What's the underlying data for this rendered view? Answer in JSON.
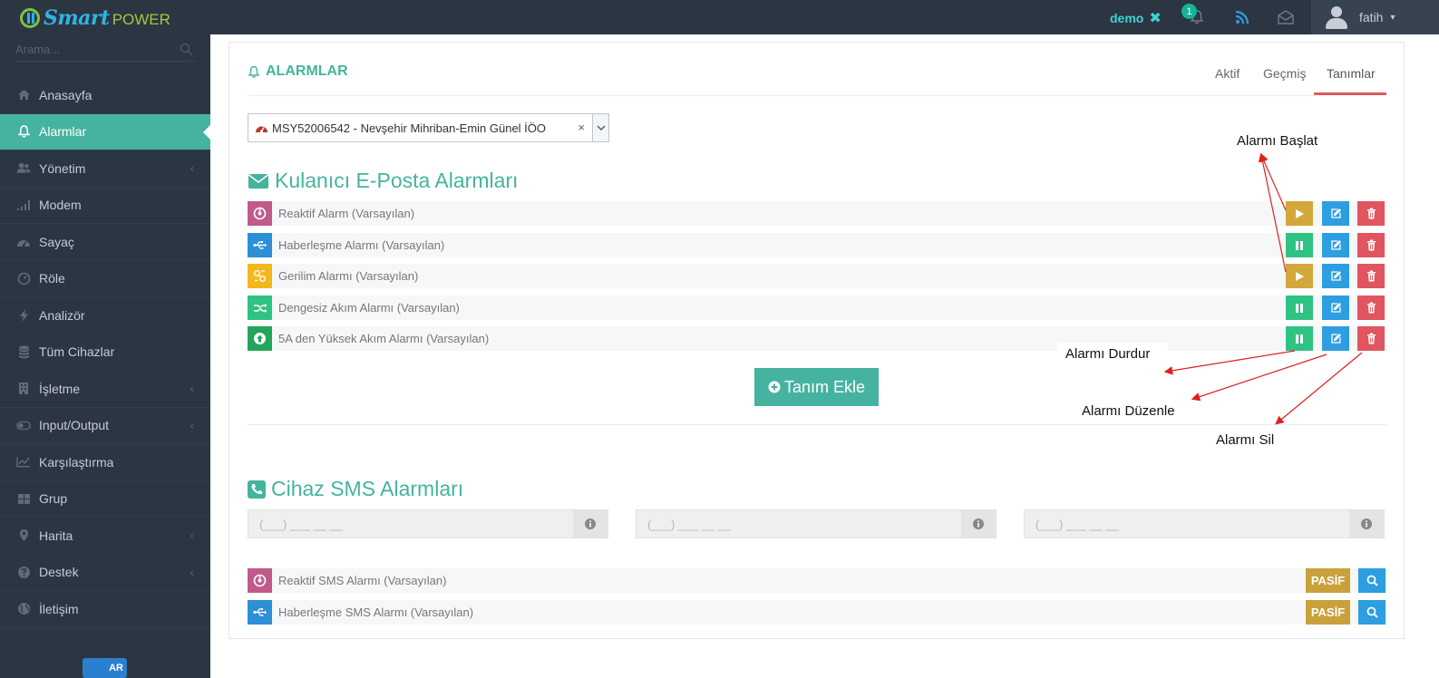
{
  "brand": {
    "smart": "Smart",
    "power": "POWER"
  },
  "topbar": {
    "demo_label": "demo",
    "notification_count": "1",
    "username": "fatih"
  },
  "sidebar": {
    "search_placeholder": "Arama...",
    "items": [
      {
        "label": "Anasayfa",
        "icon": "home-icon",
        "has_arrow": false
      },
      {
        "label": "Alarmlar",
        "icon": "bell-icon",
        "has_arrow": false,
        "active": true
      },
      {
        "label": "Yönetim",
        "icon": "users-icon",
        "has_arrow": true
      },
      {
        "label": "Modem",
        "icon": "signal-icon",
        "has_arrow": false
      },
      {
        "label": "Sayaç",
        "icon": "dashboard-icon",
        "has_arrow": false
      },
      {
        "label": "Röle",
        "icon": "gauge-icon",
        "has_arrow": false
      },
      {
        "label": "Analizör",
        "icon": "bolt-icon",
        "has_arrow": false
      },
      {
        "label": "Tüm Cihazlar",
        "icon": "database-icon",
        "has_arrow": false
      },
      {
        "label": "İşletme",
        "icon": "building-icon",
        "has_arrow": true
      },
      {
        "label": "Input/Output",
        "icon": "toggle-icon",
        "has_arrow": true
      },
      {
        "label": "Karşılaştırma",
        "icon": "line-chart-icon",
        "has_arrow": false
      },
      {
        "label": "Grup",
        "icon": "grid-icon",
        "has_arrow": false
      },
      {
        "label": "Harita",
        "icon": "map-marker-icon",
        "has_arrow": true
      },
      {
        "label": "Destek",
        "icon": "question-icon",
        "has_arrow": true
      },
      {
        "label": "İletişim",
        "icon": "globe-icon",
        "has_arrow": false
      }
    ],
    "bottom_logo_text": "AR"
  },
  "main": {
    "title": "ALARMLAR",
    "tabs": [
      {
        "label": "Aktif"
      },
      {
        "label": "Geçmiş"
      },
      {
        "label": "Tanımlar",
        "active": true
      }
    ],
    "device_select": {
      "value": "MSY52006542 - Nevşehir Mihriban-Emin Günel İÖO",
      "clear": "×"
    },
    "email_section": {
      "title": "Kulanıcı E-Posta Alarmları",
      "rows": [
        {
          "label": "Reaktif Alarm (Varsayılan)",
          "icon": "gauge-icon",
          "icon_color": "#c05a8a",
          "state": "play"
        },
        {
          "label": "Haberleşme Alarmı (Varsayılan)",
          "icon": "usb-icon",
          "icon_color": "#2d8fd5",
          "state": "pause"
        },
        {
          "label": "Gerilim Alarmı (Varsayılan)",
          "icon": "voltage-icon",
          "icon_color": "#f5b81c",
          "state": "play"
        },
        {
          "label": "Dengesiz Akım Alarmı (Varsayılan)",
          "icon": "shuffle-icon",
          "icon_color": "#2ec383",
          "state": "pause"
        },
        {
          "label": "5A den Yüksek Akım Alarmı (Varsayılan)",
          "icon": "arrow-up-circle-icon",
          "icon_color": "#23a55a",
          "state": "pause"
        }
      ],
      "add_button": "Tanım Ekle"
    },
    "sms_section": {
      "title": "Cihaz SMS Alarmları",
      "phone_placeholder": "(___) ___ __ __",
      "rows": [
        {
          "label": "Reaktif SMS Alarmı (Varsayılan)",
          "icon": "gauge-icon",
          "icon_color": "#c05a8a",
          "status": "PASİF"
        },
        {
          "label": "Haberleşme SMS Alarmı (Varsayılan)",
          "icon": "usb-icon",
          "icon_color": "#2d8fd5",
          "status": "PASİF"
        }
      ]
    }
  },
  "annotations": {
    "start": "Alarmı Başlat",
    "stop": "Alarmı Durdur",
    "edit": "Alarmı Düzenle",
    "delete": "Alarmı Sil"
  },
  "colors": {
    "topbar": "#2c3542",
    "accent": "#45b39f",
    "play": "#d3a73a",
    "pause": "#2ec383",
    "edit": "#2d9ee0",
    "delete": "#e05560",
    "arrow": "#e02020"
  }
}
